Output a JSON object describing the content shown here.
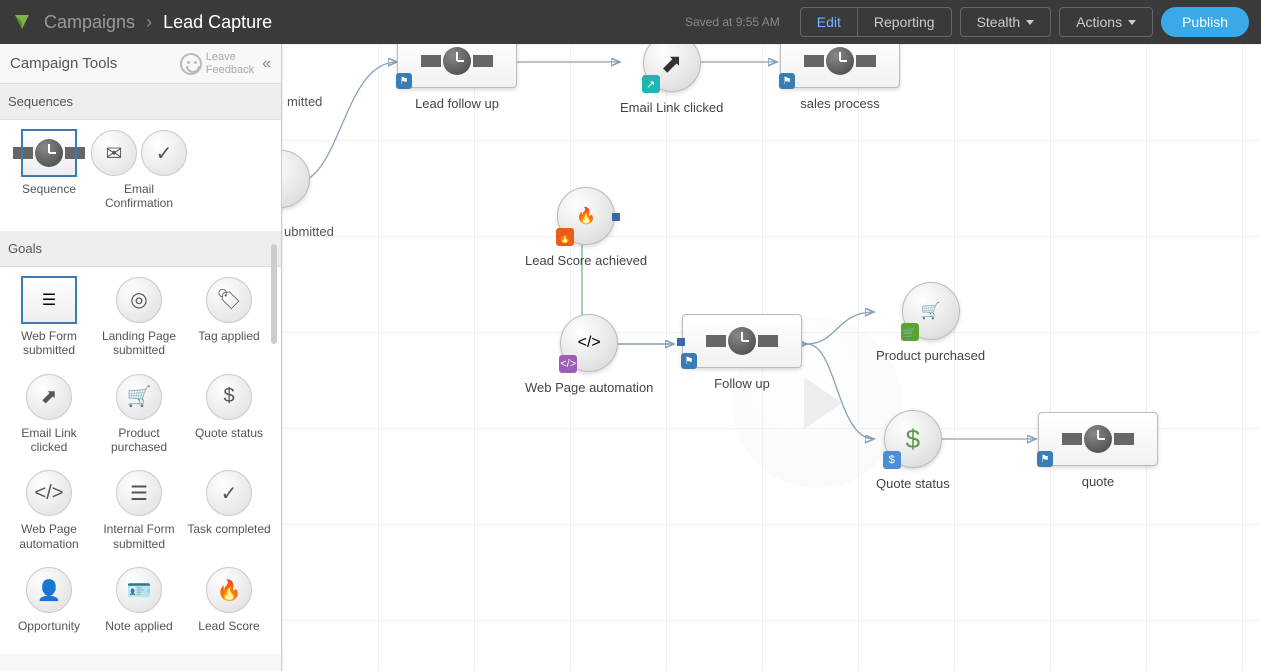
{
  "header": {
    "breadcrumb_root": "Campaigns",
    "breadcrumb_current": "Lead Capture",
    "saved_text": "Saved at 9:55 AM",
    "edit": "Edit",
    "reporting": "Reporting",
    "stealth": "Stealth",
    "actions": "Actions",
    "publish": "Publish"
  },
  "sidebar": {
    "title": "Campaign Tools",
    "feedback_l1": "Leave",
    "feedback_l2": "Feedback",
    "section_sequences": "Sequences",
    "section_goals": "Goals",
    "tools_seq": [
      {
        "label": "Sequence"
      },
      {
        "label": "Email Confirmation"
      }
    ],
    "tools_goals": [
      {
        "label": "Web Form submitted"
      },
      {
        "label": "Landing Page submitted"
      },
      {
        "label": "Tag applied"
      },
      {
        "label": "Email Link clicked"
      },
      {
        "label": "Product purchased"
      },
      {
        "label": "Quote status"
      },
      {
        "label": "Web Page automation"
      },
      {
        "label": "Internal Form submitted"
      },
      {
        "label": "Task completed"
      },
      {
        "label": "Opportunity"
      },
      {
        "label": "Note applied"
      },
      {
        "label": "Lead Score"
      }
    ]
  },
  "canvas": {
    "truncated1": "mitted",
    "truncated2": "ubmitted",
    "nodes": {
      "lead_follow_up": "Lead follow up",
      "email_link_clicked": "Email Link clicked",
      "sales_process": "sales process",
      "lead_score_achieved": "Lead Score achieved",
      "web_page_automation": "Web Page automation",
      "follow_up": "Follow up",
      "product_purchased": "Product purchased",
      "quote_status": "Quote status",
      "quote": "quote"
    }
  }
}
